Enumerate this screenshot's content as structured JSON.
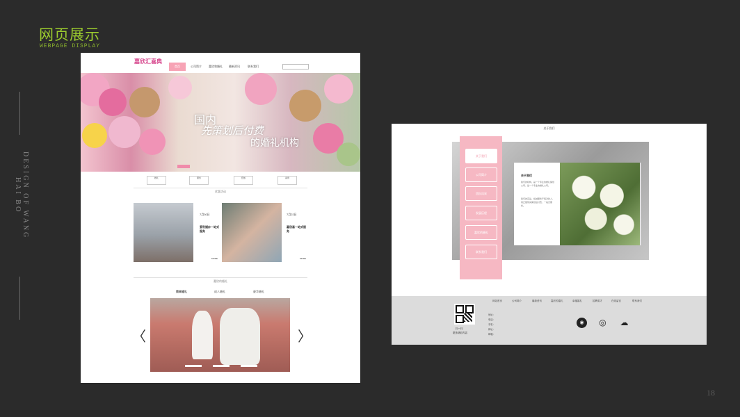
{
  "heading": "网页展示",
  "subheading": "WEBPAGE DISPLAY",
  "vertical_text": "DESIGN OF WANG HAI BO",
  "page_number": "18",
  "left_page": {
    "logo": "嘉欣汇喜典",
    "nav": [
      "首页",
      "公司简介",
      "嘉欣和婚礼",
      "最新资讯",
      "联系我们"
    ],
    "banner_line1": "国内",
    "banner_line2": "先策划后付费",
    "banner_line3": "的婚礼机构",
    "icon_buttons": [
      "婚礼",
      "服务",
      "套餐",
      "案例"
    ],
    "section1_title": "优惠活动",
    "cards": [
      {
        "date": "7月30日",
        "title": "爱利婚纱一站式服务",
        "more": "MORE"
      },
      {
        "date": "7月22日",
        "title": "嘉欣喜一站式服务",
        "more": "MORE"
      }
    ],
    "section2_title": "嘉欣的婚礼",
    "tabs": [
      "简单婚礼",
      "成人婚礼",
      "豪华婚礼"
    ],
    "arrow_left": "〈",
    "arrow_right": "〉"
  },
  "right_page": {
    "header": "关于我们",
    "menu": [
      "关于我们",
      "公司简介",
      "团队风采",
      "发展历程",
      "嘉欣的婚礼",
      "联系我们"
    ],
    "info_title": "关于我们",
    "info_body": [
      "我们的机构，是一个专业的婚礼策划公司，是一个专业的婚礼公司。",
      "我们的宗旨，竭诚服务于每对新人，真正做到先策划后付费，一站式服务。"
    ],
    "footer_nav": [
      "网站首页",
      "公司简介",
      "最新资讯",
      "嘉欣的婚礼",
      "幸福婚礼",
      "招聘英才",
      "在线留言",
      "联系我们"
    ],
    "qr_caption": [
      "扫一扫",
      "更多精彩内容"
    ],
    "footer_info": [
      "地址：",
      "电话：",
      "手机：",
      "网址：",
      "邮箱："
    ],
    "social_icons": [
      "qq-icon",
      "weibo-icon",
      "wechat-icon"
    ]
  },
  "colors": {
    "accent": "#9ccc2e",
    "pink": "#f6b8c3",
    "background": "#2b2b2b"
  }
}
